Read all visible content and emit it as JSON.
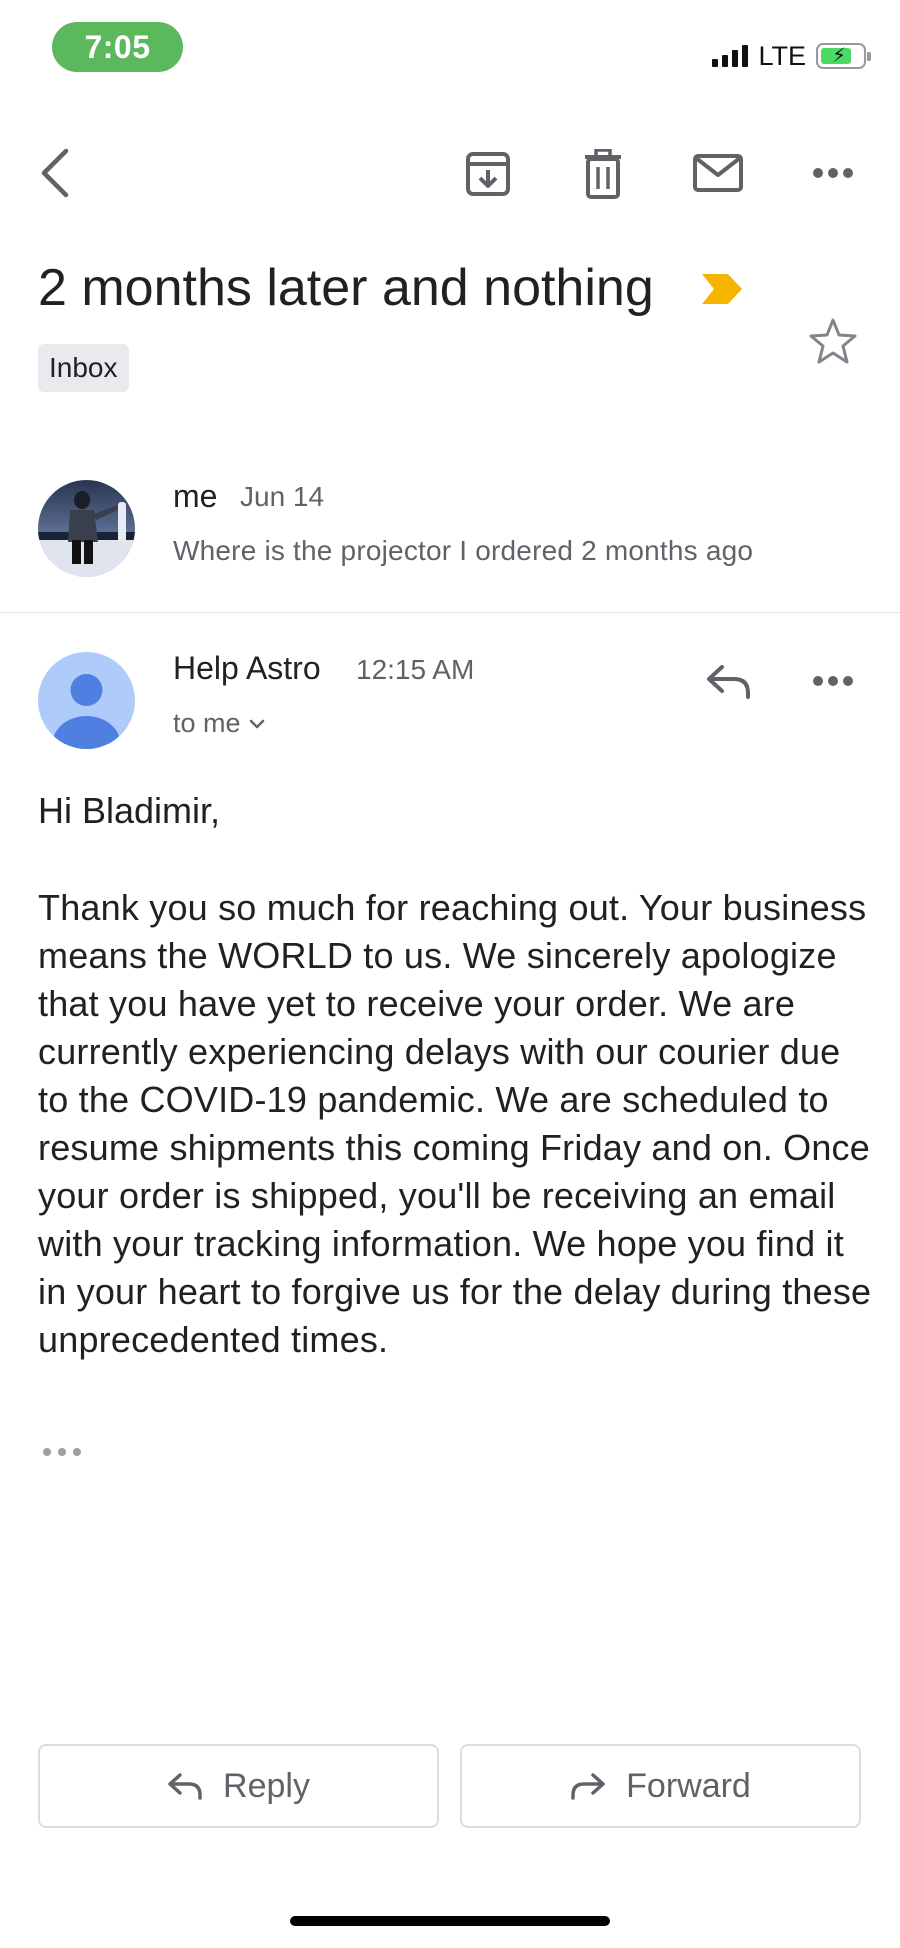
{
  "status_bar": {
    "time": "7:05",
    "network": "LTE",
    "time_pill_color": "#5cb85c",
    "battery_color": "#4cd964"
  },
  "toolbar": {
    "icons": [
      "back-arrow-icon",
      "archive-icon",
      "delete-icon",
      "mark-unread-icon",
      "more-options-icon"
    ]
  },
  "thread": {
    "subject": "2 months later and nothing",
    "importance_color": "#f4b400",
    "label": "Inbox",
    "starred": false
  },
  "messages": [
    {
      "sender": "me",
      "date": "Jun 14",
      "snippet": "Where is the projector I ordered 2 months ago",
      "collapsed": true
    },
    {
      "sender": "Help Astro",
      "time": "12:15 AM",
      "recipient": "to me",
      "avatar_color": "#aecbfa",
      "avatar_figure_color": "#4f7fe0",
      "greeting": "Hi Bladimir,",
      "body": "Thank you so much for reaching out. Your business means the WORLD to us. We sincerely apologize that you have yet to receive your order. We are currently experiencing delays with our courier due to the COVID-19 pandemic. We are scheduled to resume shipments this coming Friday and on. Once your order is shipped, you'll be receiving an email with your tracking information. We hope you find it in your heart to forgive us for the delay during these unprecedented times."
    }
  ],
  "actions": {
    "reply_label": "Reply",
    "forward_label": "Forward"
  }
}
